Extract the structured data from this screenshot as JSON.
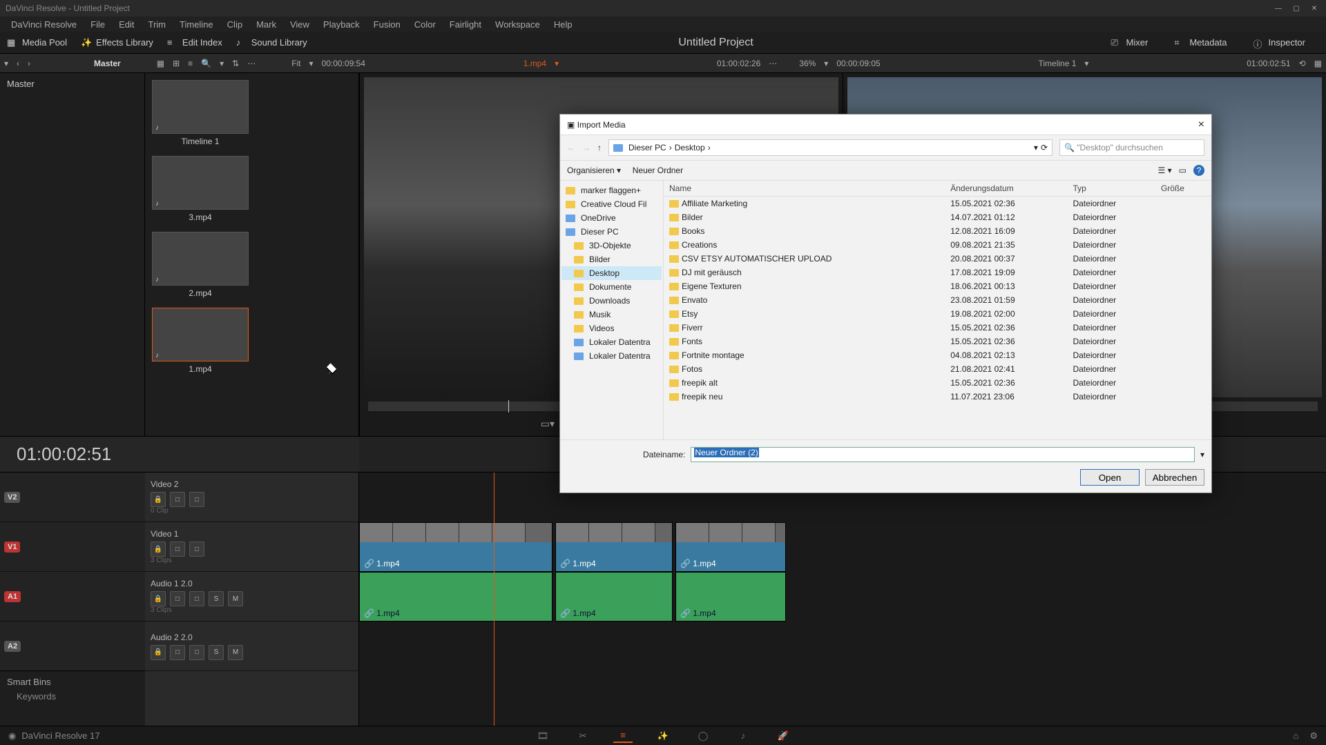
{
  "window": {
    "title": "DaVinci Resolve - Untitled Project"
  },
  "menus": [
    "DaVinci Resolve",
    "File",
    "Edit",
    "Trim",
    "Timeline",
    "Clip",
    "Mark",
    "View",
    "Playback",
    "Fusion",
    "Color",
    "Fairlight",
    "Workspace",
    "Help"
  ],
  "toolbar": {
    "media_pool": "Media Pool",
    "effects_library": "Effects Library",
    "edit_index": "Edit Index",
    "sound_library": "Sound Library",
    "project_title": "Untitled Project",
    "mixer": "Mixer",
    "metadata": "Metadata",
    "inspector": "Inspector"
  },
  "secbar": {
    "master": "Master",
    "fit": "Fit",
    "src_tc": "00:00:09:54",
    "src_name": "1.mp4",
    "rec_tc": "01:00:02:26",
    "zoom": "36%",
    "rec_tc2": "00:00:09:05",
    "timeline_name": "Timeline 1",
    "tl_tc": "01:00:02:51"
  },
  "media_tree": {
    "root": "Master"
  },
  "clips": [
    {
      "label": "Timeline 1"
    },
    {
      "label": "3.mp4"
    },
    {
      "label": "2.mp4"
    },
    {
      "label": "1.mp4",
      "selected": true
    }
  ],
  "smartbins": {
    "title": "Smart Bins",
    "item": "Keywords"
  },
  "timeline": {
    "tc": "01:00:02:51",
    "tracks": [
      {
        "id": "V2",
        "label": "Video 2",
        "clips": "0 Clip"
      },
      {
        "id": "V1",
        "label": "Video 1",
        "clips": "3 Clips",
        "active": true
      },
      {
        "id": "A1",
        "label": "Audio 1",
        "clips": "3 Clips",
        "meter": "2.0",
        "active": true
      },
      {
        "id": "A2",
        "label": "Audio 2",
        "meter": "2.0"
      }
    ],
    "clip_label": "1.mp4",
    "btns": {
      "s": "S",
      "m": "M",
      "lock": "🔒",
      "auto": "□"
    }
  },
  "pagebar": {
    "app": "DaVinci Resolve 17",
    "pages": [
      "🎞",
      "✂",
      "≡",
      "✨",
      "◯",
      "♪",
      "🚀"
    ]
  },
  "dialog": {
    "title": "Import Media",
    "close": "×",
    "back": "←",
    "fwd": "→",
    "up": "↑",
    "refresh": "⟳",
    "path": [
      "Dieser PC",
      "Desktop"
    ],
    "search_ph": "\"Desktop\" durchsuchen",
    "organize": "Organisieren ▾",
    "new_folder": "Neuer Ordner",
    "view": "☰",
    "pane": "▭",
    "help": "?",
    "tree": [
      {
        "label": "marker flaggen+",
        "icon": "folder"
      },
      {
        "label": "Creative Cloud Fil",
        "icon": "folder"
      },
      {
        "label": "OneDrive",
        "icon": "drive"
      },
      {
        "label": "Dieser PC",
        "icon": "drive"
      },
      {
        "label": "3D-Objekte",
        "icon": "folder",
        "indent": true
      },
      {
        "label": "Bilder",
        "icon": "folder",
        "indent": true
      },
      {
        "label": "Desktop",
        "icon": "folder",
        "indent": true,
        "selected": true
      },
      {
        "label": "Dokumente",
        "icon": "folder",
        "indent": true
      },
      {
        "label": "Downloads",
        "icon": "folder",
        "indent": true
      },
      {
        "label": "Musik",
        "icon": "folder",
        "indent": true
      },
      {
        "label": "Videos",
        "icon": "folder",
        "indent": true
      },
      {
        "label": "Lokaler Datentra",
        "icon": "drive",
        "indent": true
      },
      {
        "label": "Lokaler Datentra",
        "icon": "drive",
        "indent": true
      }
    ],
    "columns": [
      "Name",
      "Änderungsdatum",
      "Typ",
      "Größe"
    ],
    "rows": [
      {
        "name": "Affiliate Marketing",
        "date": "15.05.2021 02:36",
        "type": "Dateiordner"
      },
      {
        "name": "Bilder",
        "date": "14.07.2021 01:12",
        "type": "Dateiordner"
      },
      {
        "name": "Books",
        "date": "12.08.2021 16:09",
        "type": "Dateiordner"
      },
      {
        "name": "Creations",
        "date": "09.08.2021 21:35",
        "type": "Dateiordner"
      },
      {
        "name": "CSV ETSY AUTOMATISCHER UPLOAD",
        "date": "20.08.2021 00:37",
        "type": "Dateiordner"
      },
      {
        "name": "DJ mit geräusch",
        "date": "17.08.2021 19:09",
        "type": "Dateiordner"
      },
      {
        "name": "Eigene Texturen",
        "date": "18.06.2021 00:13",
        "type": "Dateiordner"
      },
      {
        "name": "Envato",
        "date": "23.08.2021 01:59",
        "type": "Dateiordner"
      },
      {
        "name": "Etsy",
        "date": "19.08.2021 02:00",
        "type": "Dateiordner"
      },
      {
        "name": "Fiverr",
        "date": "15.05.2021 02:36",
        "type": "Dateiordner"
      },
      {
        "name": "Fonts",
        "date": "15.05.2021 02:36",
        "type": "Dateiordner"
      },
      {
        "name": "Fortnite montage",
        "date": "04.08.2021 02:13",
        "type": "Dateiordner"
      },
      {
        "name": "Fotos",
        "date": "21.08.2021 02:41",
        "type": "Dateiordner"
      },
      {
        "name": "freepik alt",
        "date": "15.05.2021 02:36",
        "type": "Dateiordner"
      },
      {
        "name": "freepik neu",
        "date": "11.07.2021 23:06",
        "type": "Dateiordner"
      }
    ],
    "filename_label": "Dateiname:",
    "filename_value": "Neuer Ordner (2)",
    "open": "Open",
    "cancel": "Abbrechen"
  }
}
